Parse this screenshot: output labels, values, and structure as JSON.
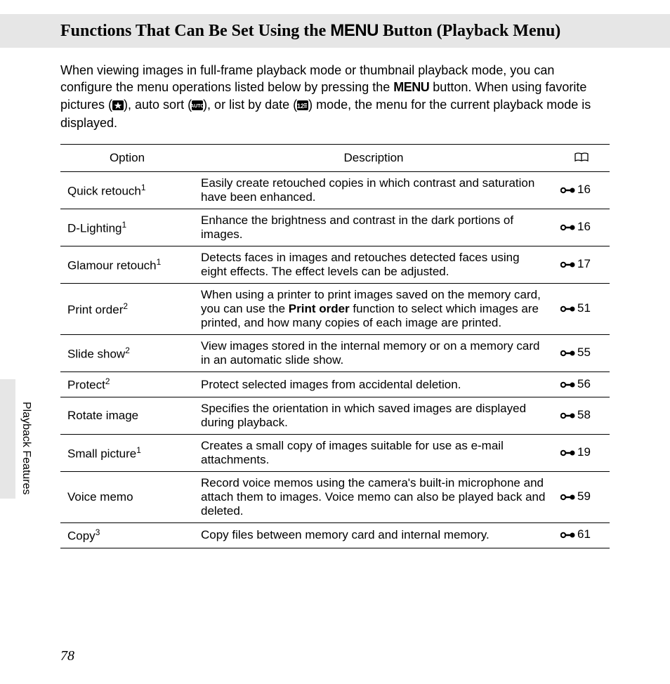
{
  "title": {
    "pre": "Functions That Can Be Set Using the ",
    "menu": "MENU",
    "post": " Button (Playback Menu)"
  },
  "intro": {
    "t1": "When viewing images in full-frame playback mode or thumbnail playback mode, you can configure the menu operations listed below by pressing the ",
    "menu": "MENU",
    "t2": " button. When using favorite pictures (",
    "t3": "), auto sort (",
    "t4": "), or list by date (",
    "t5": ") mode, the menu for the current playback mode is displayed."
  },
  "headers": {
    "option": "Option",
    "description": "Description"
  },
  "rows": [
    {
      "opt": "Quick retouch",
      "sup": "1",
      "desc": "Easily create retouched copies in which contrast and saturation have been enhanced.",
      "ref": "16"
    },
    {
      "opt": "D-Lighting",
      "sup": "1",
      "desc": "Enhance the brightness and contrast in the dark portions of images.",
      "ref": "16"
    },
    {
      "opt": "Glamour retouch",
      "sup": "1",
      "desc": "Detects faces in images and retouches detected faces using eight effects. The effect levels can be adjusted.",
      "ref": "17"
    },
    {
      "opt": "Print order",
      "sup": "2",
      "desc_pre": "When using a printer to print images saved on the memory card, you can use the ",
      "desc_bold": "Print order",
      "desc_post": " function to select which images are printed, and how many copies of each image are printed.",
      "ref": "51"
    },
    {
      "opt": "Slide show",
      "sup": "2",
      "desc": "View images stored in the internal memory or on a memory card in an automatic slide show.",
      "ref": "55"
    },
    {
      "opt": "Protect",
      "sup": "2",
      "desc": "Protect selected images from accidental deletion.",
      "ref": "56"
    },
    {
      "opt": "Rotate image",
      "sup": "",
      "desc": "Specifies the orientation in which saved images are displayed during playback.",
      "ref": "58"
    },
    {
      "opt": "Small picture",
      "sup": "1",
      "desc": "Creates a small copy of images suitable for use as e-mail attachments.",
      "ref": "19"
    },
    {
      "opt": "Voice memo",
      "sup": "",
      "desc": "Record voice memos using the camera's built-in microphone and attach them to images. Voice memo can also be played back and deleted.",
      "ref": "59"
    },
    {
      "opt": "Copy",
      "sup": "3",
      "desc": "Copy files between memory card and internal memory.",
      "ref": "61"
    }
  ],
  "sidelabel": "Playback Features",
  "pagenum": "78"
}
